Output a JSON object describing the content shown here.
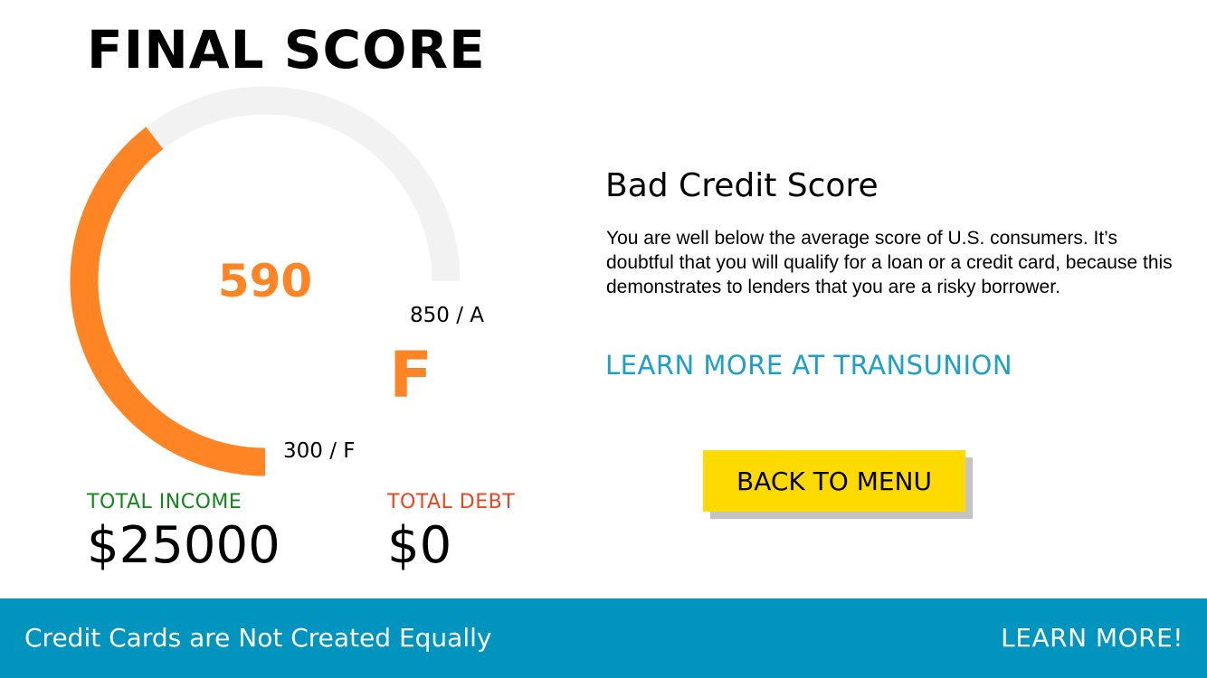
{
  "screen": {
    "title": "FINAL SCORE"
  },
  "gauge": {
    "score": "590",
    "grade": "F",
    "max_label": "850 / A",
    "min_label": "300 / F",
    "score_min": 300,
    "score_max": 850,
    "score_value": 590,
    "fill_color": "#FF8424",
    "track_color": "#F2F2F2"
  },
  "totals": {
    "income_label": "TOTAL INCOME",
    "income_value": "$25000",
    "income_color": "#14871B",
    "debt_label": "TOTAL DEBT",
    "debt_value": "$0",
    "debt_color": "#E64722"
  },
  "rating": {
    "heading": "Bad Credit Score",
    "description": "You are well below the average score of U.S. consumers. It’s doubtful that you will qualify for a loan or a credit card, because this demonstrates to lenders that you are a risky borrower.",
    "link_text": "LEARN MORE AT TRANSUNION",
    "link_color": "#1C9FC8"
  },
  "menu_button": {
    "label": "BACK TO MENU",
    "color": "#FFDA00"
  },
  "footer": {
    "text": "Credit Cards are Not Created Equally",
    "link": "LEARN MORE!",
    "color": "#0094BE"
  },
  "colors": {
    "score_text": "#FF8424"
  }
}
